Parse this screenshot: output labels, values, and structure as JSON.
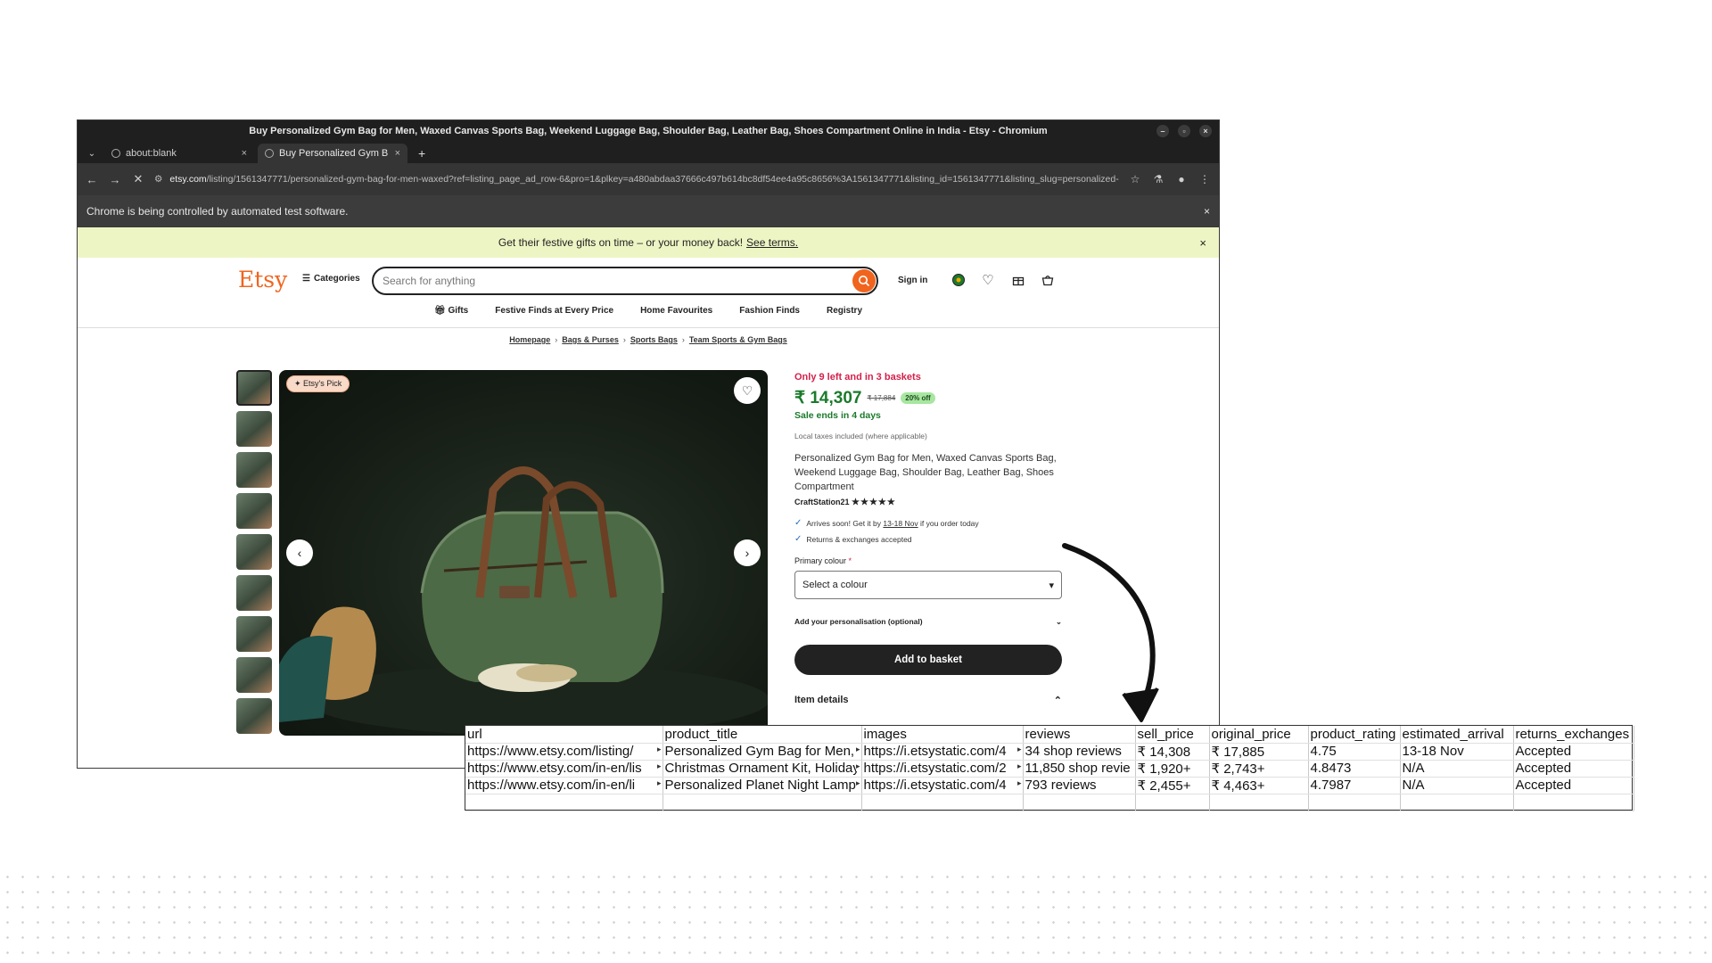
{
  "browser": {
    "window_title": "Buy Personalized Gym Bag for Men, Waxed Canvas Sports Bag, Weekend Luggage Bag, Shoulder Bag, Leather Bag, Shoes Compartment Online in India - Etsy - Chromium",
    "tabs": [
      {
        "label": "about:blank",
        "close": "×"
      },
      {
        "label": "Buy Personalized Gym B",
        "close": "×"
      }
    ],
    "new_tab": "+",
    "url_domain": "etsy.com",
    "url_path": "/listing/1561347771/personalized-gym-bag-for-men-waxed?ref=listing_page_ad_row-6&pro=1&plkey=a480abdaa37666c497b614bc8df54ee4a95c8656%3A1561347771&listing_id=1561347771&listing_slug=personalized-gym-bag-fo...",
    "infobar_text": "Chrome is being controlled by automated test software.",
    "infobar_close": "×"
  },
  "page": {
    "banner_text": "Get their festive gifts on time – or your money back!",
    "banner_link": "See terms.",
    "banner_close": "×",
    "logo": "Etsy",
    "categories_label": "Categories",
    "search_placeholder": "Search for anything",
    "signin_label": "Sign in",
    "subnav": [
      "Gifts",
      "Festive Finds at Every Price",
      "Home Favourites",
      "Fashion Finds",
      "Registry"
    ],
    "breadcrumb": [
      "Homepage",
      "Bags & Purses",
      "Sports Bags",
      "Team Sports & Gym Bags"
    ],
    "etsys_pick": "Etsy's Pick",
    "stock_text": "Only 9 left and in 3 baskets",
    "price": "₹ 14,307",
    "original_price": "₹ 17,884",
    "discount": "20% off",
    "sale_text": "Sale ends in 4 days",
    "tax_text": "Local taxes included (where applicable)",
    "product_title": "Personalized Gym Bag for Men, Waxed Canvas Sports Bag, Weekend Luggage Bag, Shoulder Bag, Leather Bag, Shoes Compartment",
    "shop_name": "CraftStation21",
    "stars": "★★★★★",
    "arrival_prefix": "Arrives soon! Get it by",
    "arrival_dates": "13-18 Nov",
    "arrival_suffix": "if you order today",
    "returns_text": "Returns & exchanges accepted",
    "colour_label": "Primary colour",
    "colour_required": "*",
    "colour_select": "Select a colour",
    "personalisation_label": "Add your personalisation (optional)",
    "basket_button": "Add to basket",
    "item_details": "Item details"
  },
  "colors": {
    "etsy_orange": "#f1641e",
    "price_green": "#1b7a2c",
    "stock_red": "#d3204a",
    "banner_bg": "#eef5c4"
  },
  "sheet": {
    "headers": [
      "url",
      "product_title",
      "images",
      "reviews",
      "sell_price",
      "original_price",
      "product_rating",
      "estimated_arrival",
      "returns_exchanges"
    ],
    "rows": [
      [
        "https://www.etsy.com/listing/",
        "Personalized Gym Bag for Men,",
        "https://i.etsystatic.com/4",
        "34 shop reviews",
        "₹ 14,308",
        "₹ 17,885",
        "4.75",
        "13-18 Nov",
        "Accepted"
      ],
      [
        "https://www.etsy.com/in-en/lis",
        "Christmas Ornament Kit, Holiday",
        "https://i.etsystatic.com/2",
        "11,850 shop revie",
        "₹ 1,920+",
        "₹ 2,743+",
        "4.8473",
        "N/A",
        "Accepted"
      ],
      [
        "https://www.etsy.com/in-en/li",
        "Personalized Planet Night Lamp",
        "https://i.etsystatic.com/4",
        "793 reviews",
        "₹ 2,455+",
        "₹ 4,463+",
        "4.7987",
        "N/A",
        "Accepted"
      ]
    ]
  }
}
